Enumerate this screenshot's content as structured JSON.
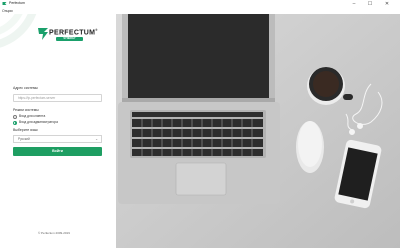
{
  "window": {
    "title": "Perfectum",
    "minimize": "–",
    "maximize": "☐",
    "close": "✕"
  },
  "menu": {
    "items": [
      "Опции"
    ]
  },
  "brand": {
    "name": "PERFECTUM",
    "registered": "®",
    "tagline": "SYNERGY",
    "accent": "#1aa06b"
  },
  "form": {
    "address_label": "Адрес системы",
    "address_placeholder": "https://ip-perfectum-server",
    "mode_label": "Режим системы",
    "mode_options": [
      {
        "label": "Вход для клиента",
        "checked": false
      },
      {
        "label": "Вход для администратора",
        "checked": true
      }
    ],
    "language_label": "Выберите язык",
    "language_value": "Русский",
    "submit_label": "Войти"
  },
  "footer": {
    "copyright": "© Perfectum 2009-2019"
  },
  "photo": {
    "description_icon": "desk-laptop-coffee-photo"
  }
}
